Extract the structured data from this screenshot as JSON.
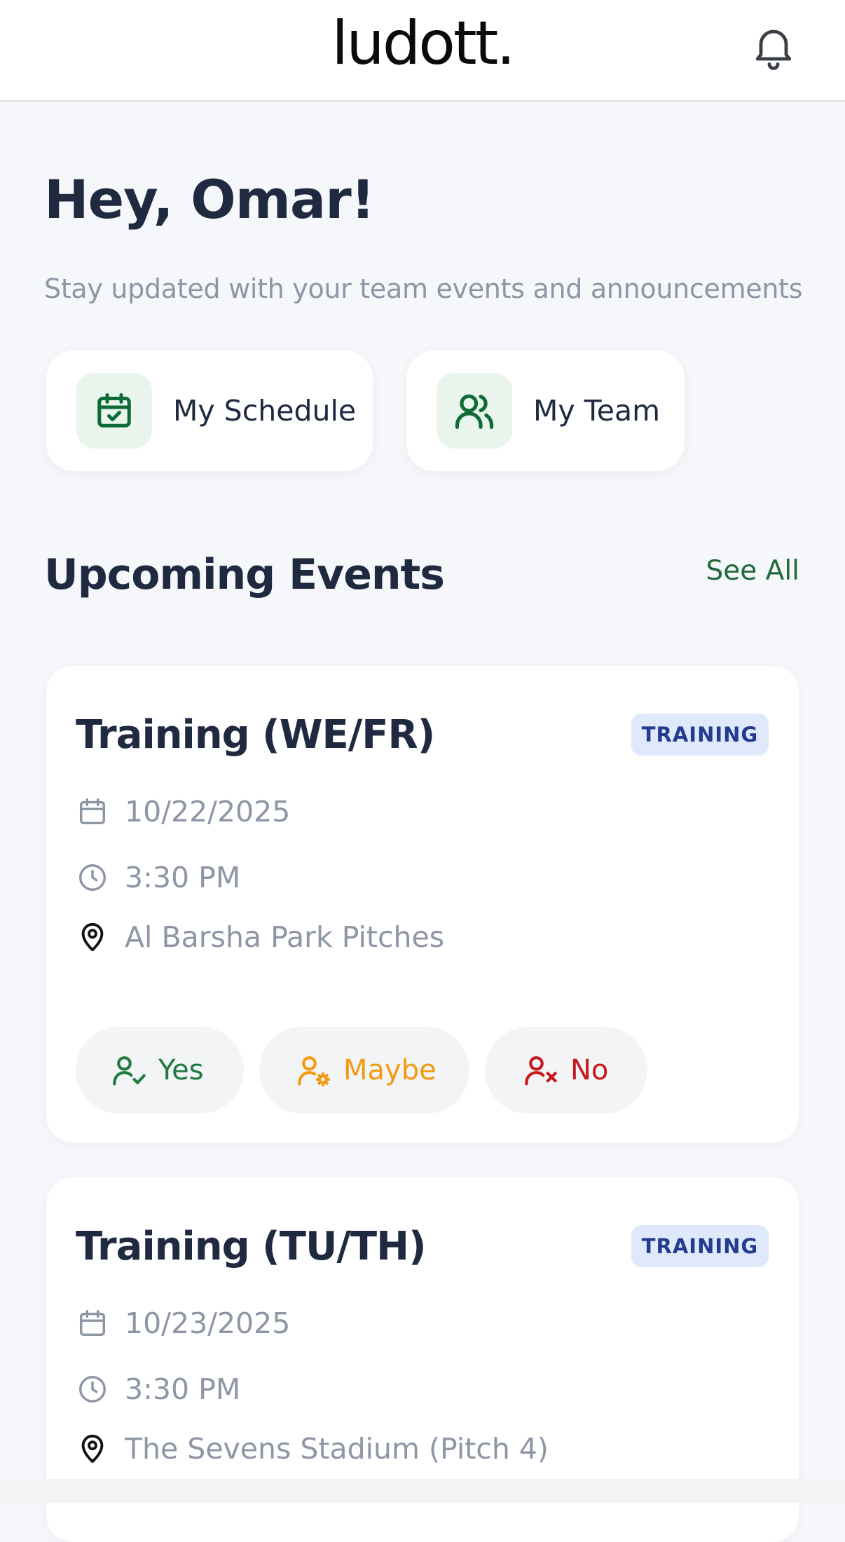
{
  "header": {
    "logo": "ludott.",
    "notification_icon": "bell-icon"
  },
  "greeting": "Hey, Omar!",
  "subtitle": "Stay updated with your team events and announcements",
  "quick_actions": [
    {
      "label": "My Schedule",
      "icon": "calendar-check-icon"
    },
    {
      "label": "My Team",
      "icon": "users-icon"
    }
  ],
  "events_section": {
    "title": "Upcoming Events",
    "see_all": "See All"
  },
  "events": [
    {
      "title": "Training (WE/FR)",
      "badge": "TRAINING",
      "date": "10/22/2025",
      "time": "3:30 PM",
      "location": "Al Barsha Park Pitches",
      "rsvp": {
        "yes": "Yes",
        "maybe": "Maybe",
        "no": "No"
      }
    },
    {
      "title": "Training (TU/TH)",
      "badge": "TRAINING",
      "date": "10/23/2025",
      "time": "3:30 PM",
      "location": "The Sevens Stadium (Pitch 4)"
    }
  ],
  "colors": {
    "brand_green": "#0e6b35",
    "yes": "#1f7a3e",
    "maybe": "#f29a12",
    "no": "#c8161d",
    "badge_bg": "#dfe9fb",
    "badge_text": "#233c8f"
  }
}
